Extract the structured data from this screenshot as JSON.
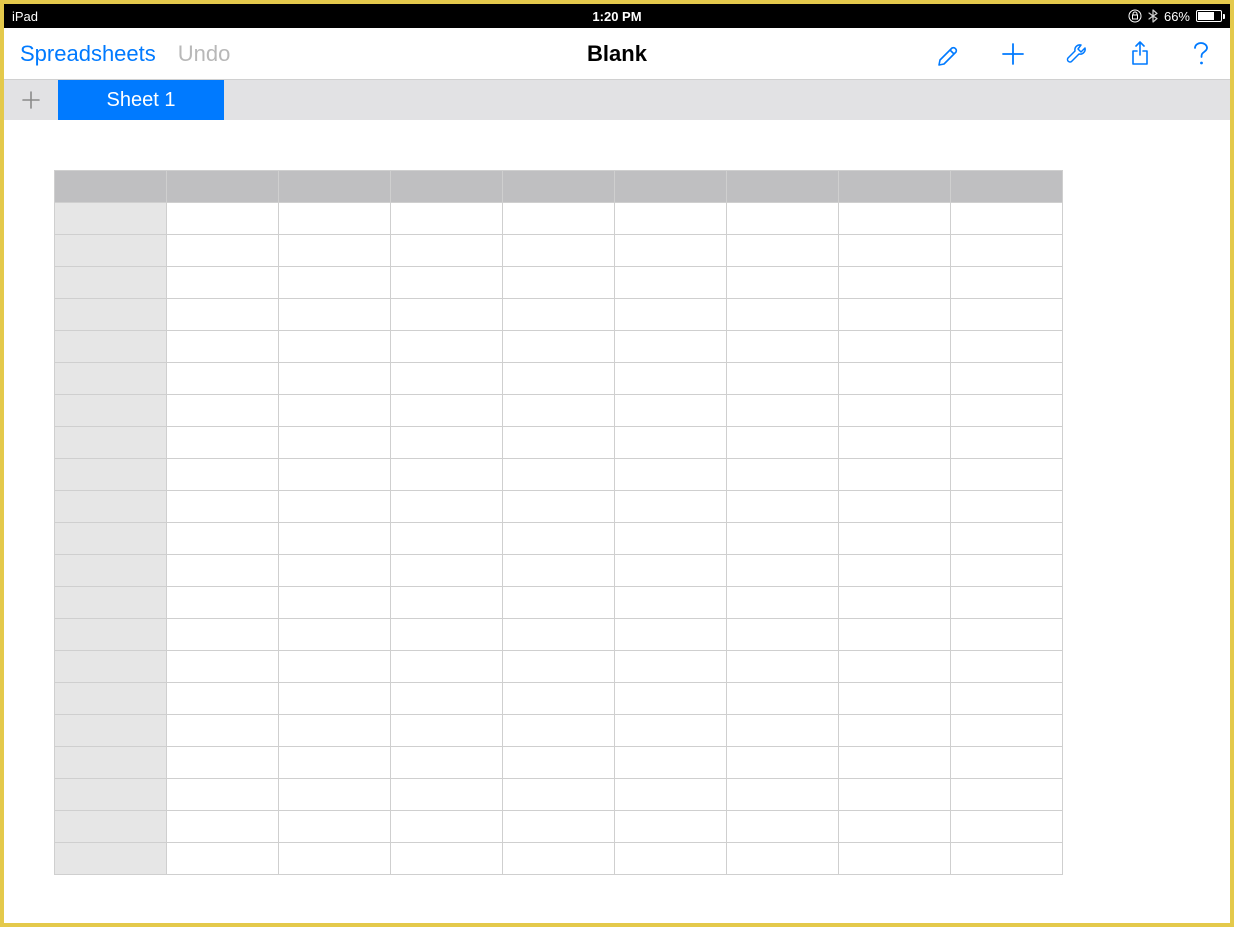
{
  "status_bar": {
    "device": "iPad",
    "time": "1:20 PM",
    "battery_pct": "66%"
  },
  "toolbar": {
    "back_label": "Spreadsheets",
    "undo_label": "Undo",
    "doc_title": "Blank"
  },
  "tabs": {
    "active": "Sheet 1"
  },
  "grid": {
    "columns": 9,
    "rows": 21
  }
}
